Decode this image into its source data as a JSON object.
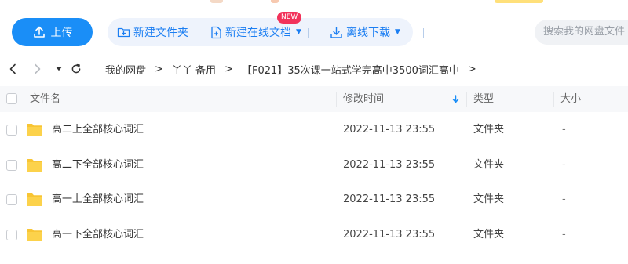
{
  "colors": {
    "accent": "#1a8ef7",
    "toolbar_bg": "#eef3fc",
    "badge": "#f2325a",
    "folder": "#f8c534",
    "header_bg": "#f7f8fa"
  },
  "toolbar": {
    "upload_label": "上传",
    "new_folder_label": "新建文件夹",
    "new_online_doc_label": "新建在线文档",
    "new_badge": "NEW",
    "offline_download_label": "离线下载"
  },
  "search": {
    "placeholder": "搜索我的网盘文件"
  },
  "nav": {
    "icons": [
      "back-arrow-icon",
      "forward-arrow-icon",
      "history-dropdown-icon",
      "refresh-icon"
    ],
    "breadcrumb": [
      {
        "label": "我的网盘"
      },
      {
        "label": "丫丫 备用"
      },
      {
        "label": "【F021】35次课一站式学完高中3500词汇高中"
      }
    ],
    "separator": ">"
  },
  "table": {
    "columns": {
      "name": "文件名",
      "mtime": "修改时间",
      "type": "类型",
      "size": "大小"
    },
    "sort": {
      "column": "mtime",
      "direction": "desc"
    },
    "rows": [
      {
        "name": "高二上全部核心词汇",
        "mtime": "2022-11-13 23:55",
        "type": "文件夹",
        "size": "-"
      },
      {
        "name": "高二下全部核心词汇",
        "mtime": "2022-11-13 23:55",
        "type": "文件夹",
        "size": "-"
      },
      {
        "name": "高一上全部核心词汇",
        "mtime": "2022-11-13 23:55",
        "type": "文件夹",
        "size": "-"
      },
      {
        "name": "高一下全部核心词汇",
        "mtime": "2022-11-13 23:55",
        "type": "文件夹",
        "size": "-"
      }
    ]
  }
}
